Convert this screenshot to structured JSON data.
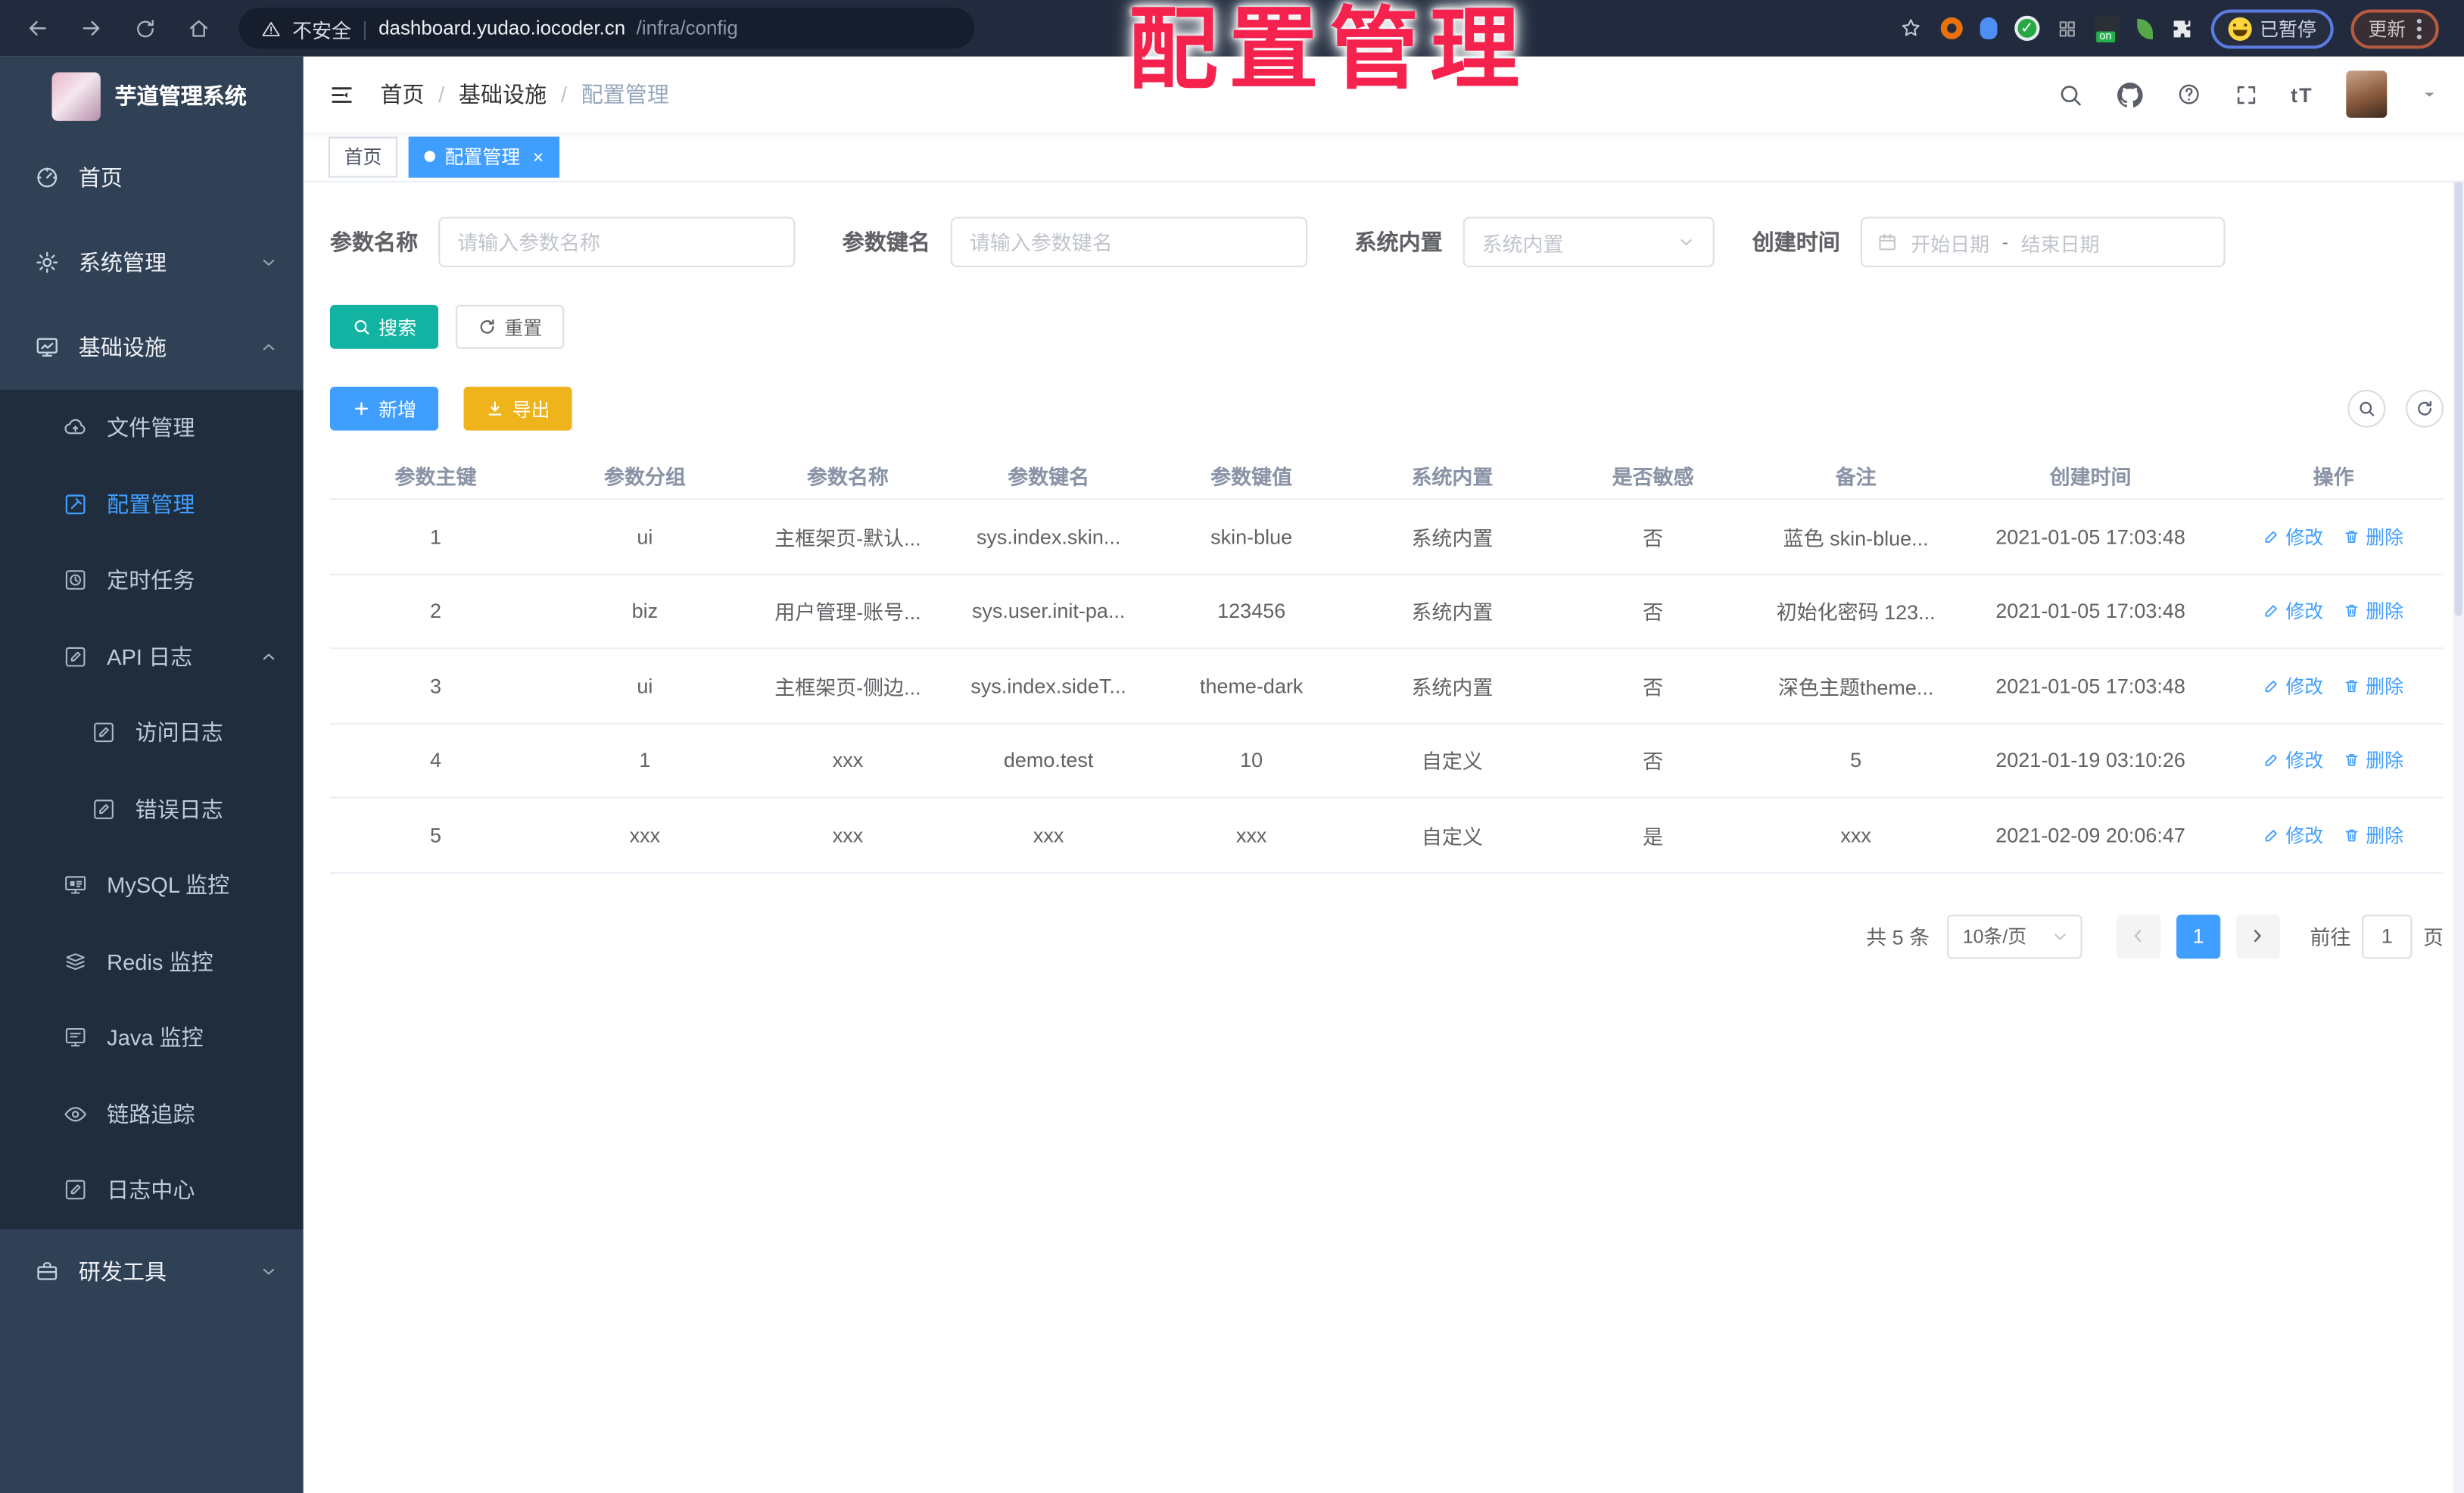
{
  "overlay_title": "配置管理",
  "browser": {
    "security_label": "不安全",
    "url_domain": "dashboard.yudao.iocoder.cn",
    "url_path": "/infra/config",
    "paused_badge": "已暂停",
    "update_button": "更新"
  },
  "sidebar": {
    "app_title": "芋道管理系统",
    "items": [
      {
        "label": "首页",
        "icon": "dashboard-icon",
        "level": 0
      },
      {
        "label": "系统管理",
        "icon": "gear-icon",
        "level": 0,
        "chevron": "down"
      },
      {
        "label": "基础设施",
        "icon": "infrastructure-icon",
        "level": 0,
        "chevron": "up"
      },
      {
        "label": "文件管理",
        "icon": "cloud-upload-icon",
        "level": 1
      },
      {
        "label": "配置管理",
        "icon": "edit-square-icon",
        "level": 1,
        "active": true
      },
      {
        "label": "定时任务",
        "icon": "clock-icon",
        "level": 1
      },
      {
        "label": "API 日志",
        "icon": "log-icon",
        "level": 1,
        "chevron": "up"
      },
      {
        "label": "访问日志",
        "icon": "log-icon",
        "level": 2
      },
      {
        "label": "错误日志",
        "icon": "log-icon",
        "level": 2
      },
      {
        "label": "MySQL 监控",
        "icon": "mysql-monitor-icon",
        "level": 1
      },
      {
        "label": "Redis 监控",
        "icon": "redis-monitor-icon",
        "level": 1
      },
      {
        "label": "Java 监控",
        "icon": "java-monitor-icon",
        "level": 1
      },
      {
        "label": "链路追踪",
        "icon": "eye-icon",
        "level": 1
      },
      {
        "label": "日志中心",
        "icon": "log-icon",
        "level": 1
      },
      {
        "label": "研发工具",
        "icon": "briefcase-icon",
        "level": 0,
        "chevron": "down"
      }
    ]
  },
  "header": {
    "breadcrumb": [
      "首页",
      "基础设施",
      "配置管理"
    ]
  },
  "tabs": [
    {
      "label": "首页",
      "active": false
    },
    {
      "label": "配置管理",
      "active": true
    }
  ],
  "filters": {
    "name_label": "参数名称",
    "name_placeholder": "请输入参数名称",
    "key_label": "参数键名",
    "key_placeholder": "请输入参数键名",
    "type_label": "系统内置",
    "type_placeholder": "系统内置",
    "date_label": "创建时间",
    "date_start_placeholder": "开始日期",
    "date_separator": "-",
    "date_end_placeholder": "结束日期",
    "search_button": "搜索",
    "reset_button": "重置"
  },
  "toolbar": {
    "add_button": "新增",
    "export_button": "导出"
  },
  "table": {
    "columns": [
      "参数主键",
      "参数分组",
      "参数名称",
      "参数键名",
      "参数键值",
      "系统内置",
      "是否敏感",
      "备注",
      "创建时间",
      "操作"
    ],
    "edit_label": "修改",
    "delete_label": "删除",
    "rows": [
      [
        "1",
        "ui",
        "主框架页-默认...",
        "sys.index.skin...",
        "skin-blue",
        "系统内置",
        "否",
        "蓝色 skin-blue...",
        "2021-01-05 17:03:48"
      ],
      [
        "2",
        "biz",
        "用户管理-账号...",
        "sys.user.init-pa...",
        "123456",
        "系统内置",
        "否",
        "初始化密码 123...",
        "2021-01-05 17:03:48"
      ],
      [
        "3",
        "ui",
        "主框架页-侧边...",
        "sys.index.sideT...",
        "theme-dark",
        "系统内置",
        "否",
        "深色主题theme...",
        "2021-01-05 17:03:48"
      ],
      [
        "4",
        "1",
        "xxx",
        "demo.test",
        "10",
        "自定义",
        "否",
        "5",
        "2021-01-19 03:10:26"
      ],
      [
        "5",
        "xxx",
        "xxx",
        "xxx",
        "xxx",
        "自定义",
        "是",
        "xxx",
        "2021-02-09 20:06:47"
      ]
    ]
  },
  "pagination": {
    "total": "共 5 条",
    "page_size": "10条/页",
    "current_page": "1",
    "goto_label": "前往",
    "goto_value": "1",
    "page_unit": "页"
  },
  "colors": {
    "accent": "#409eff",
    "search_teal": "#12b3a2",
    "export_yellow": "#efb41b",
    "overlay_red": "#f5224d",
    "sidebar_bg": "#304156",
    "submenu_bg": "#1f2d3d"
  }
}
